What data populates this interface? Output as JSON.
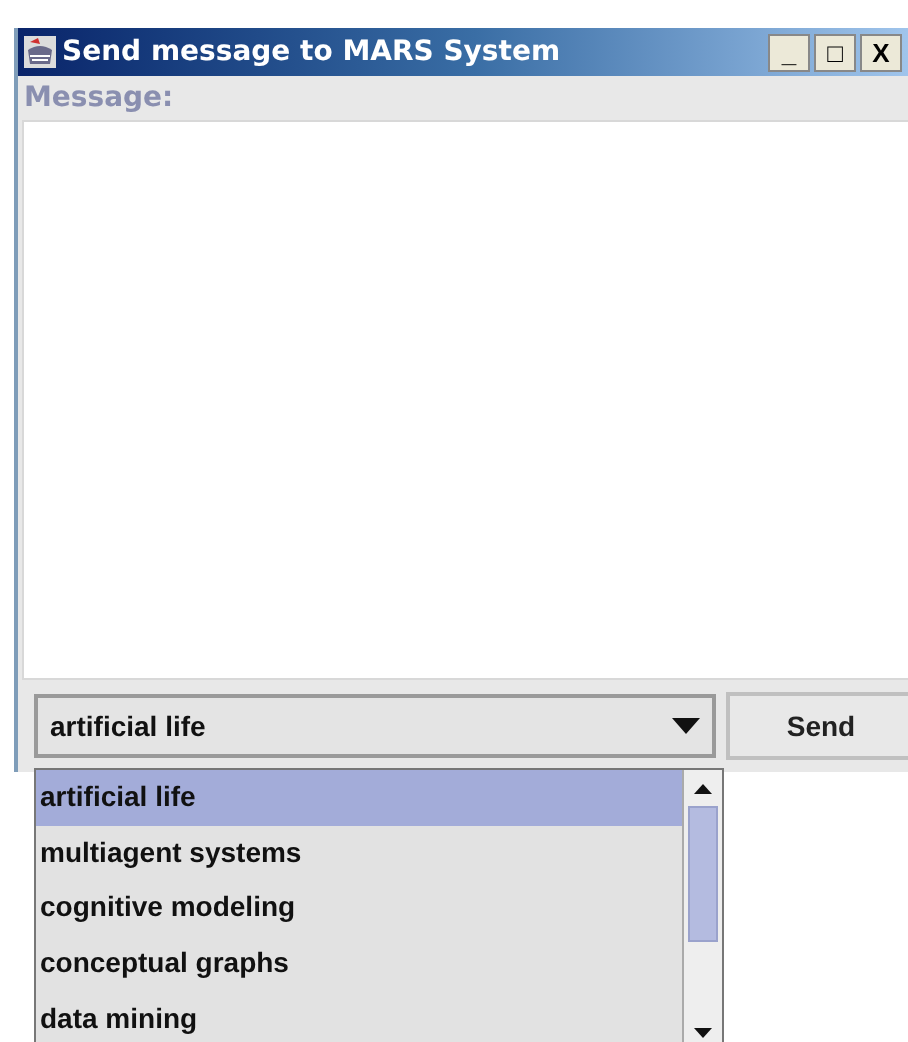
{
  "window": {
    "title": "Send message to MARS System",
    "controls": [
      "_",
      "□",
      "X"
    ]
  },
  "message": {
    "label": "Message:"
  },
  "topic_select": {
    "value": "artificial life"
  },
  "send_button": {
    "label": "Send"
  },
  "dropdown": {
    "items": [
      {
        "label": "artificial life",
        "selected": true
      },
      {
        "label": "multiagent systems",
        "selected": false
      },
      {
        "label": "cognitive modeling",
        "selected": false
      },
      {
        "label": "conceptual graphs",
        "selected": false
      },
      {
        "label": "data mining",
        "selected": false
      }
    ]
  }
}
